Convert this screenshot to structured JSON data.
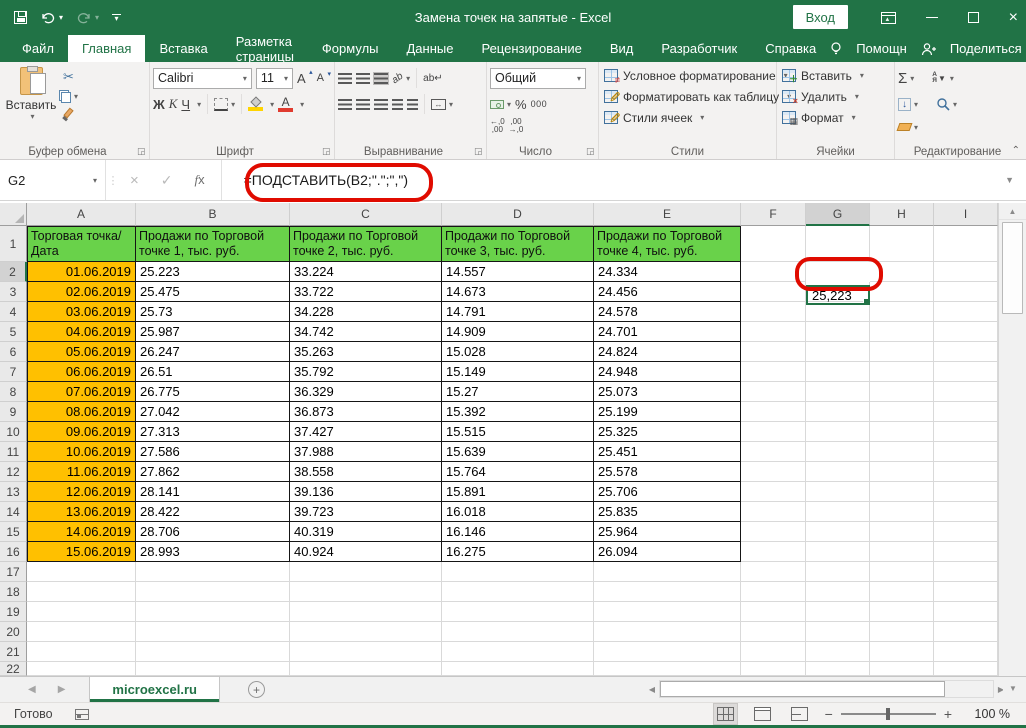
{
  "title_bar": {
    "title": "Замена точек на запятые  -  Excel",
    "sign_in": "Вход"
  },
  "tabs": {
    "file": "Файл",
    "home": "Главная",
    "insert": "Вставка",
    "page_layout": "Разметка страницы",
    "formulas": "Формулы",
    "data": "Данные",
    "review": "Рецензирование",
    "view": "Вид",
    "developer": "Разработчик",
    "reference": "Справка",
    "assistant": "Помощн",
    "share": "Поделиться"
  },
  "ribbon": {
    "clipboard": {
      "label": "Буфер обмена",
      "paste": "Вставить"
    },
    "font": {
      "label": "Шрифт",
      "font_name": "Calibri",
      "font_size": "11",
      "bold": "Ж",
      "italic": "К",
      "underline": "Ч",
      "grow": "А",
      "shrink": "А",
      "font_color_letter": "А",
      "fill_color": "#ffd400",
      "font_color": "#e03b2f"
    },
    "alignment": {
      "label": "Выравнивание",
      "orientation": "ab",
      "wrap": "ab↵"
    },
    "number": {
      "label": "Число",
      "format": "Общий",
      "percent": "%",
      "thousands": "000",
      "inc_decimal": "←,0 ,00",
      "dec_decimal": "→,00"
    },
    "styles": {
      "label": "Стили",
      "items": [
        "Условное форматирование",
        "Форматировать как таблицу",
        "Стили ячеек"
      ]
    },
    "cells": {
      "label": "Ячейки",
      "items": [
        "Вставить",
        "Удалить",
        "Формат"
      ]
    },
    "editing": {
      "label": "Редактирование",
      "sigma": "Σ",
      "sort_a": "А",
      "sort_z": "Я"
    }
  },
  "formula_bar": {
    "name_box": "G2",
    "formula": "=ПОДСТАВИТЬ(B2;\".\";\",\")"
  },
  "sheet": {
    "columns": [
      "A",
      "B",
      "C",
      "D",
      "E",
      "F",
      "G",
      "H",
      "I"
    ],
    "selected_column": "G",
    "selected_row": 2,
    "header_row": [
      "Торговая точка/ Дата",
      "Продажи по Торговой точке 1, тыс. руб.",
      "Продажи по Торговой точке 2, тыс. руб.",
      "Продажи по Торговой точке 3, тыс. руб.",
      "Продажи по Торговой точке 4, тыс. руб."
    ],
    "rows": [
      {
        "row": 2,
        "date": "01.06.2019",
        "values": [
          "25.223",
          "33.224",
          "14.557",
          "24.334"
        ]
      },
      {
        "row": 3,
        "date": "02.06.2019",
        "values": [
          "25.475",
          "33.722",
          "14.673",
          "24.456"
        ]
      },
      {
        "row": 4,
        "date": "03.06.2019",
        "values": [
          "25.73",
          "34.228",
          "14.791",
          "24.578"
        ]
      },
      {
        "row": 5,
        "date": "04.06.2019",
        "values": [
          "25.987",
          "34.742",
          "14.909",
          "24.701"
        ]
      },
      {
        "row": 6,
        "date": "05.06.2019",
        "values": [
          "26.247",
          "35.263",
          "15.028",
          "24.824"
        ]
      },
      {
        "row": 7,
        "date": "06.06.2019",
        "values": [
          "26.51",
          "35.792",
          "15.149",
          "24.948"
        ]
      },
      {
        "row": 8,
        "date": "07.06.2019",
        "values": [
          "26.775",
          "36.329",
          "15.27",
          "25.073"
        ]
      },
      {
        "row": 9,
        "date": "08.06.2019",
        "values": [
          "27.042",
          "36.873",
          "15.392",
          "25.199"
        ]
      },
      {
        "row": 10,
        "date": "09.06.2019",
        "values": [
          "27.313",
          "37.427",
          "15.515",
          "25.325"
        ]
      },
      {
        "row": 11,
        "date": "10.06.2019",
        "values": [
          "27.586",
          "37.988",
          "15.639",
          "25.451"
        ]
      },
      {
        "row": 12,
        "date": "11.06.2019",
        "values": [
          "27.862",
          "38.558",
          "15.764",
          "25.578"
        ]
      },
      {
        "row": 13,
        "date": "12.06.2019",
        "values": [
          "28.141",
          "39.136",
          "15.891",
          "25.706"
        ]
      },
      {
        "row": 14,
        "date": "13.06.2019",
        "values": [
          "28.422",
          "39.723",
          "16.018",
          "25.835"
        ]
      },
      {
        "row": 15,
        "date": "14.06.2019",
        "values": [
          "28.706",
          "40.319",
          "16.146",
          "25.964"
        ]
      },
      {
        "row": 16,
        "date": "15.06.2019",
        "values": [
          "28.993",
          "40.924",
          "16.275",
          "26.094"
        ]
      }
    ],
    "g2_value": "25,223",
    "empty_rows": [
      17,
      18,
      19,
      20,
      21,
      22
    ],
    "colors": {
      "header_green": "#69d24a",
      "date_orange": "#ffc000",
      "excel_green": "#217346",
      "annotation_red": "#e00b00"
    }
  },
  "sheet_tabs": {
    "active": "microexcel.ru"
  },
  "status_bar": {
    "ready": "Готово",
    "zoom": "100 %"
  }
}
